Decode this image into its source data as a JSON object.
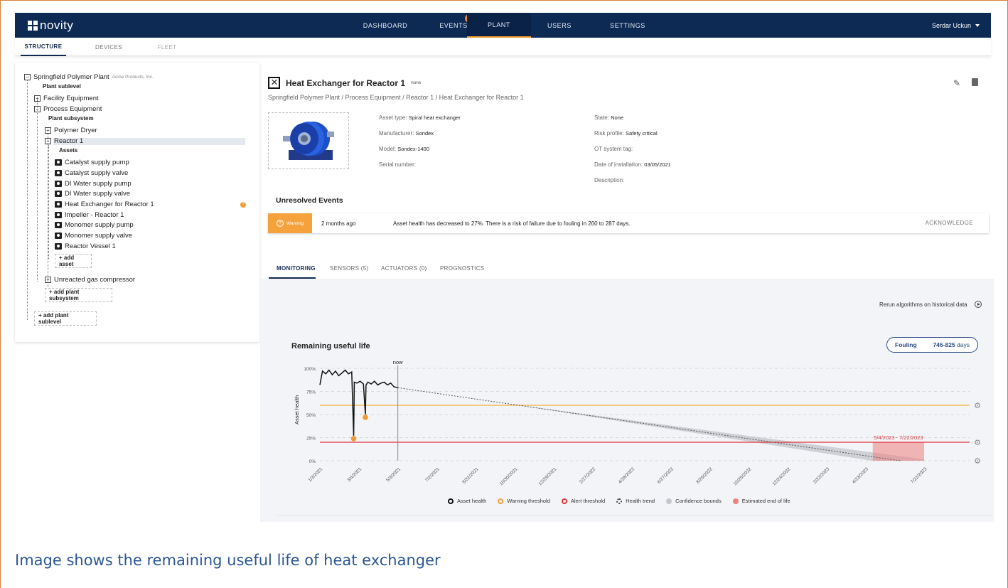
{
  "app": {
    "name": "novity"
  },
  "nav": {
    "tabs": [
      {
        "label": "DASHBOARD"
      },
      {
        "label": "EVENTS",
        "badge": "1"
      },
      {
        "label": "PLANT"
      },
      {
        "label": "USERS"
      },
      {
        "label": "SETTINGS"
      }
    ],
    "user": "Serdar Uckun"
  },
  "subtabs": [
    "STRUCTURE",
    "DEVICES",
    "FLEET"
  ],
  "tree": {
    "plant": "Springfield Polymer Plant",
    "company": "Acme Products, Inc.",
    "plant_sublevel_label": "Plant sublevel",
    "facility": "Facility Equipment",
    "process": "Process Equipment",
    "plant_subsystem_label": "Plant subsystem",
    "dryer": "Polymer Dryer",
    "reactor": "Reactor 1",
    "assets_label": "Assets",
    "assets": [
      "Catalyst supply pump",
      "Catalyst supply valve",
      "DI Water supply pump",
      "DI Water supply valve",
      "Heat Exchanger for Reactor 1",
      "Impeller - Reactor 1",
      "Monomer supply pump",
      "Monomer supply valve",
      "Reactor Vessel 1"
    ],
    "add_asset": "+ add asset",
    "compressor": "Unreacted gas compressor",
    "add_subsystem": "+ add plant subsystem",
    "add_sublevel": "+ add plant sublevel"
  },
  "detail": {
    "title": "Heat Exchanger for Reactor 1",
    "tag": "none",
    "breadcrumb": "Springfield Polymer Plant / Process Equipment / Reactor 1 / Heat Exchanger for Reactor 1",
    "props_left": [
      {
        "label": "Asset type:",
        "value": "Spiral heat exchanger"
      },
      {
        "label": "Manufacturer:",
        "value": "Sondex"
      },
      {
        "label": "Model:",
        "value": "Sondex-1400"
      },
      {
        "label": "Serial number:",
        "value": ""
      }
    ],
    "props_right": [
      {
        "label": "State:",
        "value": "None"
      },
      {
        "label": "Risk profile:",
        "value": "Safety critical"
      },
      {
        "label": "OT system tag:",
        "value": ""
      },
      {
        "label": "Date of installation:",
        "value": "03/05/2021"
      },
      {
        "label": "Description:",
        "value": ""
      }
    ]
  },
  "events": {
    "title": "Unresolved Events",
    "row": {
      "severity": "Warning",
      "time": "2 months ago",
      "message": "Asset health has decreased to 27%. There is a risk of failure due to fouling in 260 to 287 days.",
      "action": "ACKNOWLEDGE"
    }
  },
  "monitor_tabs": [
    "MONITORING",
    "SENSORS (5)",
    "ACTUATORS (0)",
    "PROGNOSTICS"
  ],
  "monitor": {
    "rerun": "Rerun algorithms on historical data",
    "chart_title": "Remaining useful life",
    "fouling_label": "Fouling",
    "fouling_range": "746-825",
    "fouling_unit": "days"
  },
  "colors": {
    "nav": "#0d2a55",
    "warning": "#f5a23c",
    "alert": "#e0353b",
    "accent": "#2c4a86"
  },
  "chart_data": {
    "type": "line",
    "title": "Remaining useful life",
    "xlabel": "",
    "ylabel": "Asset health",
    "x_ticks": [
      "1/3/2021",
      "3/4/2021",
      "5/3/2021",
      "7/2/2021",
      "8/31/2021",
      "10/30/2021",
      "12/29/2021",
      "2/27/2022",
      "4/28/2022",
      "6/27/2022",
      "8/26/2022",
      "10/25/2022",
      "12/24/2022",
      "2/22/2023",
      "4/23/2023",
      "7/22/2023"
    ],
    "y_ticks": [
      "0%",
      "25%",
      "50%",
      "75%",
      "100%"
    ],
    "ylim": [
      0,
      100
    ],
    "now_label": "now",
    "now_date": "5/3/2021",
    "warning_threshold": 60,
    "alert_threshold": 20,
    "series": [
      {
        "name": "Asset health",
        "x": [
          "1/3/2021",
          "1/7/2021",
          "1/12/2021",
          "1/17/2021",
          "1/22/2021",
          "1/27/2021",
          "2/1/2021",
          "2/6/2021",
          "2/11/2021",
          "2/16/2021",
          "2/21/2021",
          "2/24/2021",
          "2/25/2021",
          "3/1/2021",
          "3/6/2021",
          "3/11/2021",
          "3/14/2021",
          "3/15/2021",
          "3/18/2021",
          "3/23/2021",
          "3/28/2021",
          "4/2/2021",
          "4/7/2021",
          "4/12/2021",
          "4/17/2021",
          "4/22/2021",
          "4/27/2021",
          "5/3/2021"
        ],
        "y": [
          82,
          97,
          94,
          98,
          93,
          97,
          92,
          95,
          98,
          94,
          96,
          27,
          85,
          84,
          86,
          83,
          50,
          82,
          85,
          83,
          86,
          82,
          84,
          85,
          82,
          84,
          80,
          79
        ]
      },
      {
        "name": "Health trend",
        "x": [
          "5/3/2021",
          "6/15/2023"
        ],
        "y": [
          79,
          0
        ]
      }
    ],
    "confidence_bounds": {
      "start_date": "10/30/2021",
      "end_date": "7/22/2023"
    },
    "estimated_end_of_life": {
      "label": "5/4/2023 - 7/22/2023",
      "start": "5/4/2023",
      "end": "7/22/2023"
    },
    "legend": [
      "Asset health",
      "Warning threshold",
      "Alert threshold",
      "Health trend",
      "Confidence bounds",
      "Estimated end of life"
    ]
  },
  "caption": "Image shows the remaining useful life of heat exchanger"
}
